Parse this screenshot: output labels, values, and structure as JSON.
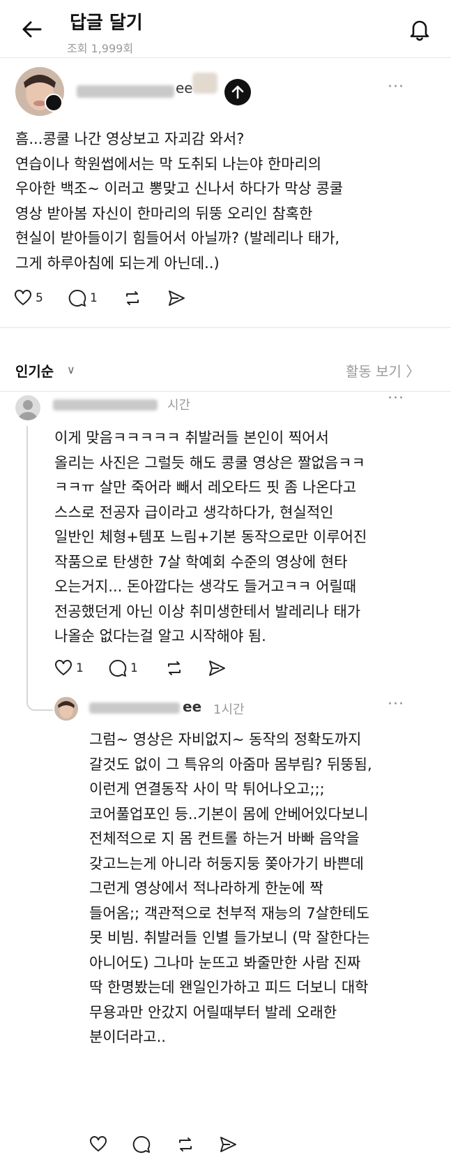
{
  "header": {
    "title": "답글 달기",
    "views": "조회 1,999회"
  },
  "post": {
    "author_tail": "ee",
    "text": "흠...콩쿨 나간 영상보고 자괴감 와서?\n연습이나 학원썹에서는 막 도취되 나는야 한마리의\n우아한 백조~ 이러고 뽕맞고 신나서 하다가 막상 콩쿨\n영상 받아봄 자신이 한마리의 뒤뚱 오리인 참혹한\n현실이 받아들이기 힘들어서 아닐까? (발레리나 태가,\n그게 하루아침에 되는게 아닌데..)",
    "likes": "5",
    "replies": "1",
    "more": "···"
  },
  "sort": {
    "label": "인기순",
    "chevron": "∨",
    "activity": "활동 보기 〉"
  },
  "comments": [
    {
      "time": "시간",
      "text": "이게 맞음ㅋㅋㅋㅋㅋ 취발러들 본인이 찍어서\n올리는 사진은 그럴듯 해도 콩쿨 영상은 짤없음ㅋㅋ\nㅋㅋㅠ 살만 죽어라 빼서 레오타드 핏 좀 나온다고\n스스로 전공자 급이라고 생각하다가, 현실적인\n일반인 체형+템포 느림+기본 동작으로만 이루어진\n작품으로 탄생한 7살 학예회 수준의 영상에 현타\n오는거지... 돈아깝다는 생각도 들거고ㅋㅋ 어릴때\n전공했던게 아닌 이상 취미생한테서 발레리나 태가\n나올순 없다는걸 알고 시작해야 됨.",
      "likes": "1",
      "replies": "1",
      "more": "···"
    },
    {
      "author_tail": "ee",
      "time": "1시간",
      "text": "그럼~ 영상은 자비없지~ 동작의 정확도까지\n갈것도 없이 그 특유의 아줌마 몸부림? 뒤뚱됨,\n이런게 연결동작 사이 막 튀어나오고;;;\n코어풀업포인 등..기본이 몸에 안베어있다보니\n전체적으로 지 몸 컨트롤 하는거 바빠 음악을\n갖고느는게 아니라 허둥지둥 쫒아가기 바쁜데\n그런게 영상에서 적나라하게 한눈에 짝\n들어옴;; 객관적으로 천부적 재능의 7살한테도\n못 비빔. 취발러들 인별 들가보니 (막 잘한다는\n아니어도) 그나마 눈뜨고 봐줄만한 사람 진짜\n딱 한명봤는데 왠일인가하고 피드 더보니 대학\n무용과만 안갔지 어릴때부터 발레 오래한\n분이더라고..",
      "more": "···"
    }
  ],
  "colors": {
    "text": "#161616",
    "muted": "#9a9a9a",
    "divider": "#e6e6e6",
    "button_dark": "#111111"
  }
}
